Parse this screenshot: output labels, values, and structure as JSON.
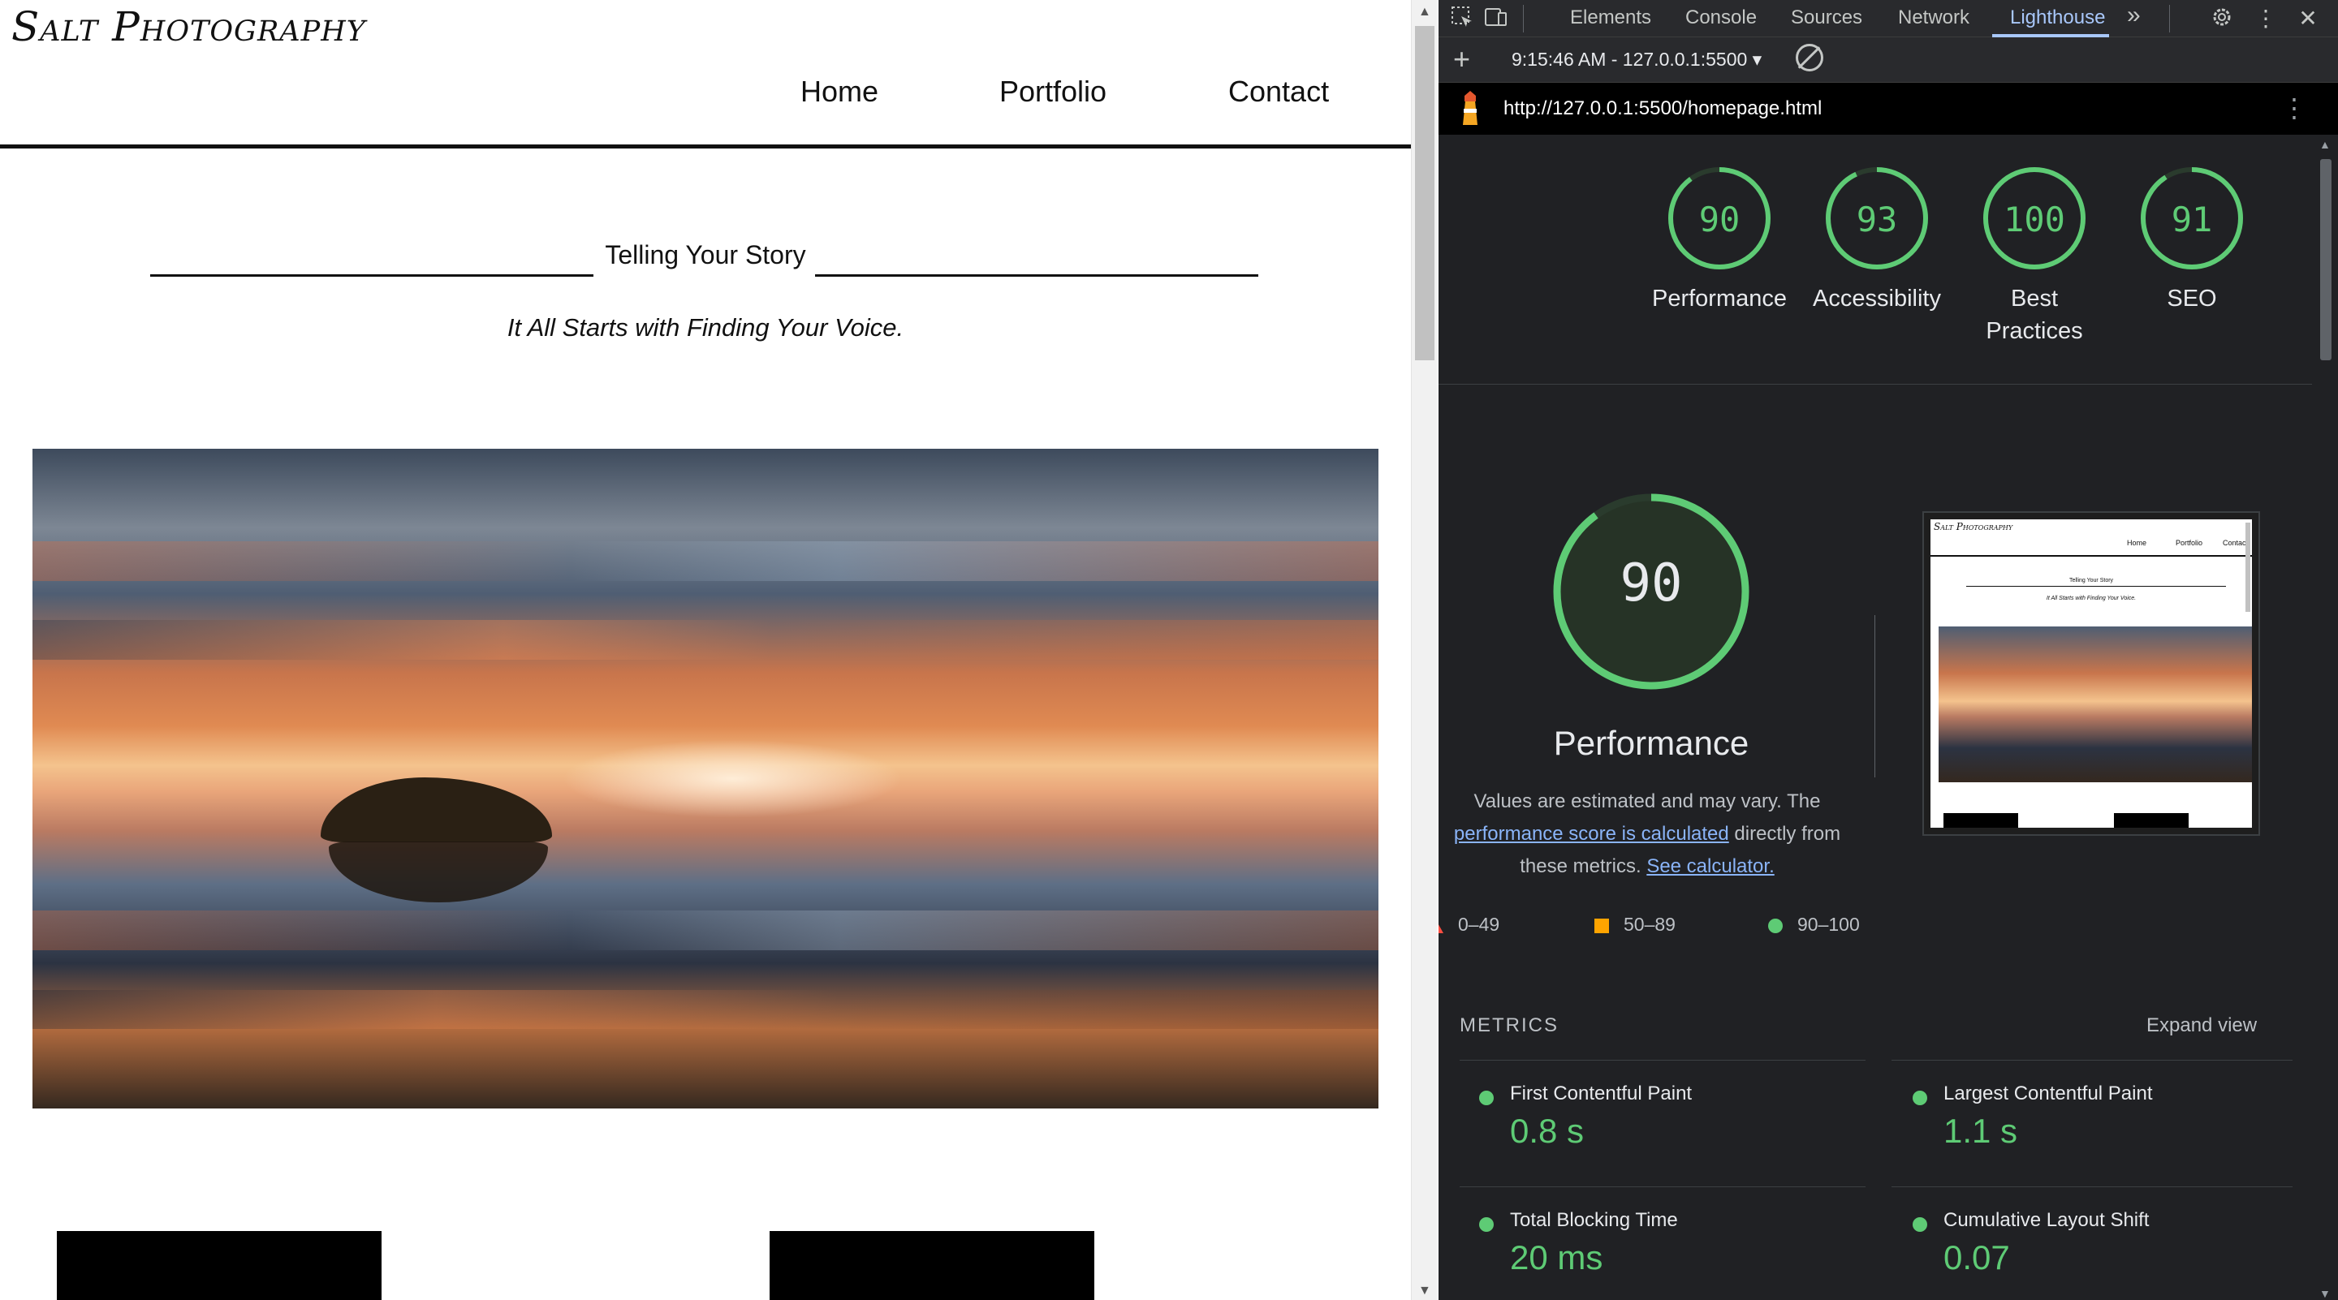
{
  "site": {
    "logo": "Salt Photography",
    "nav": {
      "home": "Home",
      "portfolio": "Portfolio",
      "contact": "Contact"
    },
    "tagline": "Telling Your Story",
    "subtagline": "It All Starts with Finding Your Voice."
  },
  "devtools": {
    "tabs": {
      "elements": "Elements",
      "console": "Console",
      "sources": "Sources",
      "network": "Network",
      "lighthouse": "Lighthouse"
    },
    "more_tabs": "»",
    "report_select": "9:15:46 AM - 127.0.0.1:5500 ▾",
    "url": "http://127.0.0.1:5500/homepage.html",
    "accent_color": "#a8c7fa"
  },
  "lighthouse": {
    "scores": [
      {
        "value": 90,
        "label": "Performance"
      },
      {
        "value": 93,
        "label": "Accessibility"
      },
      {
        "value": 100,
        "label": "Best Practices"
      },
      {
        "value": 91,
        "label": "SEO"
      }
    ],
    "pass_color": "#5ecb75",
    "performance": {
      "score": "90",
      "title": "Performance",
      "desc_prefix": "Values are estimated and may vary. The",
      "desc_link": "performance score is calculated",
      "desc_mid": "directly from these metrics.",
      "desc_link2": "See calculator."
    },
    "legend": {
      "fail": "0–49",
      "average": "50–89",
      "pass": "90–100"
    },
    "metrics_header": "METRICS",
    "expand_view": "Expand view",
    "metrics": [
      {
        "label": "First Contentful Paint",
        "value": "0.8 s"
      },
      {
        "label": "Largest Contentful Paint",
        "value": "1.1 s"
      },
      {
        "label": "Total Blocking Time",
        "value": "20 ms"
      },
      {
        "label": "Cumulative Layout Shift",
        "value": "0.07"
      }
    ],
    "thumbnail": {
      "logo": "Salt Photography",
      "nav": [
        "Home",
        "Portfolio",
        "Contact"
      ],
      "tagline": "Telling Your Story",
      "subtagline": "It All Starts with Finding Your Voice."
    }
  }
}
